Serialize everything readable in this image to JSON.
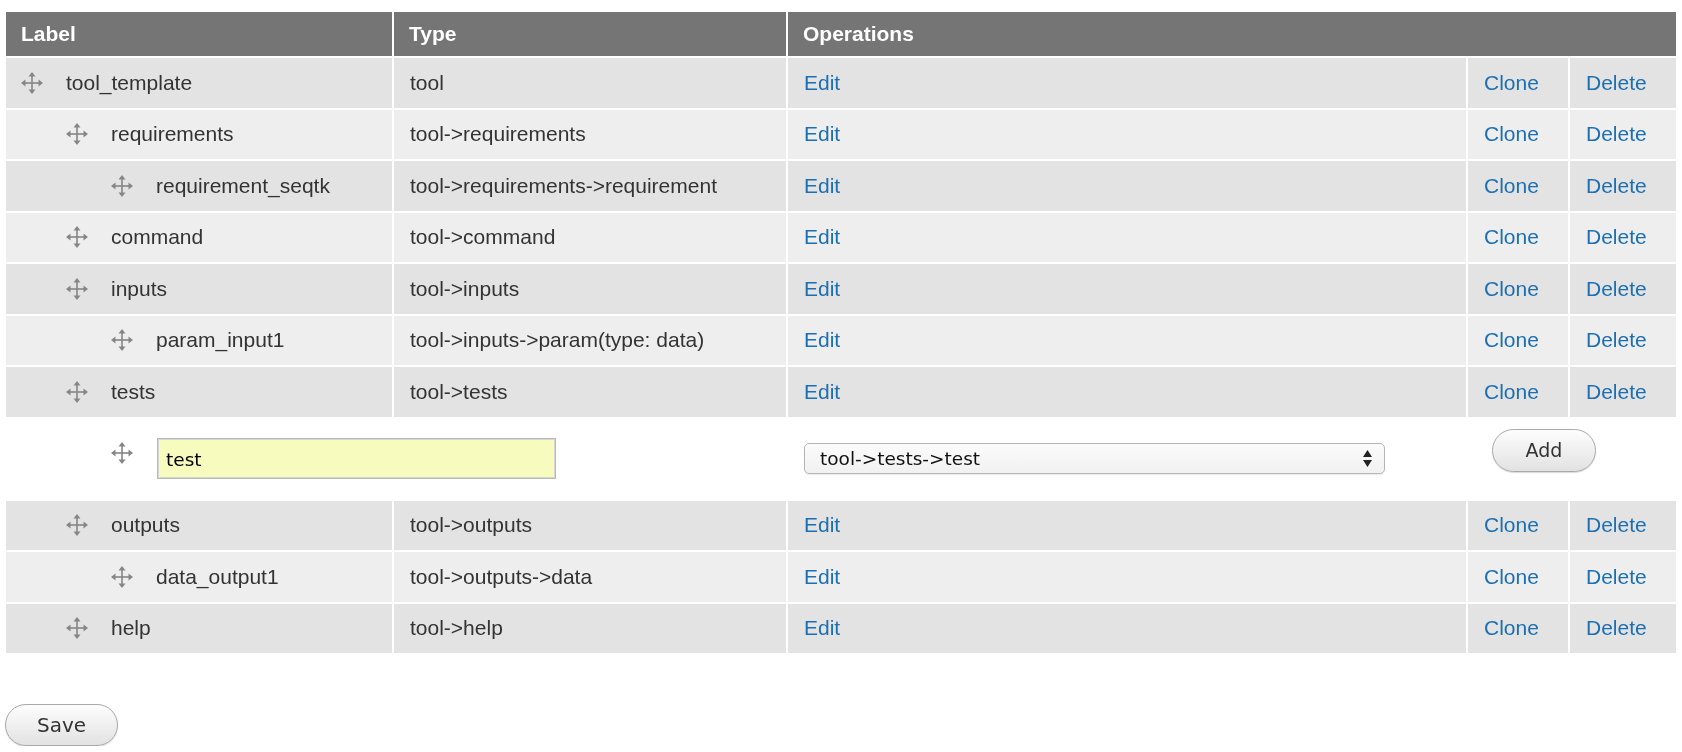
{
  "table": {
    "columns": [
      "Label",
      "Type",
      "Operations"
    ],
    "rows": [
      {
        "kind": "item",
        "label": "tool_template",
        "type": "tool",
        "operations": [
          "Edit",
          "Clone",
          "Delete"
        ],
        "children": [
          {
            "kind": "item",
            "label": "requirements",
            "type": "tool->requirements",
            "operations": [
              "Edit",
              "Clone",
              "Delete"
            ],
            "children": [
              {
                "kind": "item",
                "label": "requirement_seqtk",
                "type": "tool->requirements->requirement",
                "operations": [
                  "Edit",
                  "Clone",
                  "Delete"
                ]
              }
            ]
          },
          {
            "kind": "item",
            "label": "command",
            "type": "tool->command",
            "operations": [
              "Edit",
              "Clone",
              "Delete"
            ]
          },
          {
            "kind": "item",
            "label": "inputs",
            "type": "tool->inputs",
            "operations": [
              "Edit",
              "Clone",
              "Delete"
            ],
            "children": [
              {
                "kind": "item",
                "label": "param_input1",
                "type": "tool->inputs->param(type: data)",
                "operations": [
                  "Edit",
                  "Clone",
                  "Delete"
                ]
              }
            ]
          },
          {
            "kind": "item",
            "label": "tests",
            "type": "tool->tests",
            "operations": [
              "Edit",
              "Clone",
              "Delete"
            ],
            "children": [
              {
                "kind": "add",
                "name_input": {
                  "value": "test"
                },
                "type_select": {
                  "value": "tool->tests->test"
                },
                "button": "Add"
              }
            ]
          },
          {
            "kind": "item",
            "label": "outputs",
            "type": "tool->outputs",
            "operations": [
              "Edit",
              "Clone",
              "Delete"
            ],
            "children": [
              {
                "kind": "item",
                "label": "data_output1",
                "type": "tool->outputs->data",
                "operations": [
                  "Edit",
                  "Clone",
                  "Delete"
                ]
              }
            ]
          },
          {
            "kind": "item",
            "label": "help",
            "type": "tool->help",
            "operations": [
              "Edit",
              "Clone",
              "Delete"
            ]
          }
        ]
      }
    ]
  },
  "save_button": "Save"
}
